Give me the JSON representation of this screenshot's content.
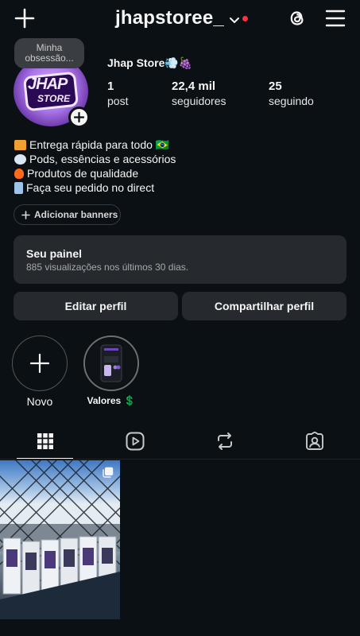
{
  "header": {
    "username": "jhapstoree_"
  },
  "profile": {
    "note": "Minha obsessão...",
    "display_name": "Jhap Store💨🍇",
    "avatar_line1": "JHAP",
    "avatar_line2": "STORE",
    "stats": [
      {
        "value": "1",
        "label": "post"
      },
      {
        "value": "22,4 mil",
        "label": "seguidores"
      },
      {
        "value": "25",
        "label": "seguindo"
      }
    ],
    "bio": [
      {
        "emoji": "truck-emoji",
        "color": "#f0a030",
        "text": "Entrega rápida para todo 🇧🇷"
      },
      {
        "emoji": "dash-emoji",
        "color": "#d9e6f5",
        "text": "Pods, essências e acessórios"
      },
      {
        "emoji": "fire-emoji",
        "color": "#ff6a1a",
        "text": "Produtos de qualidade"
      },
      {
        "emoji": "phone-emoji",
        "color": "#9cc4e8",
        "text": "Faça seu pedido no direct"
      }
    ],
    "banner_button": "Adicionar banners"
  },
  "panel": {
    "title": "Seu painel",
    "subtitle": "885 visualizações nos últimos 30 dias."
  },
  "actions": {
    "edit": "Editar perfil",
    "share": "Compartilhar perfil"
  },
  "highlights": {
    "new_label": "Novo",
    "items": [
      {
        "label": "Valores 💲"
      }
    ]
  },
  "tabs": [
    "grid-icon",
    "reels-icon",
    "reposts-icon",
    "tagged-icon"
  ],
  "colors": {
    "background": "#0b1014",
    "surface": "#262a2f",
    "notification": "#ff3040"
  }
}
